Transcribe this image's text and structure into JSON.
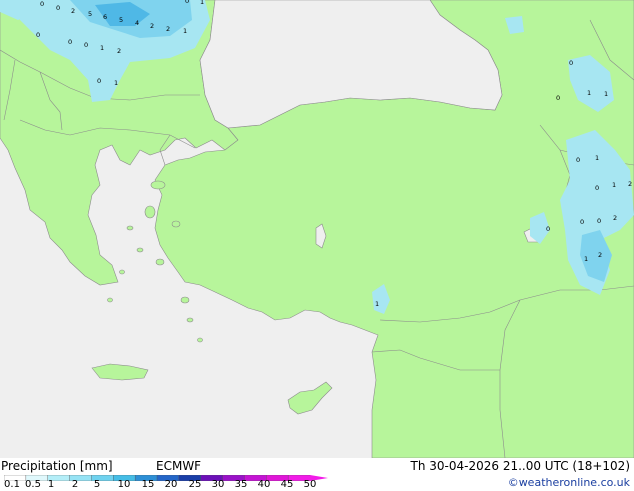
{
  "map": {
    "colors": {
      "sea": "#efefef",
      "land": "#b7f59b",
      "border": "#8c8c8c",
      "precip_light": "#a7e6f2",
      "precip_mid": "#7fd3ee",
      "precip_heavy": "#4fb8e6"
    },
    "precip_values": [
      "0",
      "0",
      "2",
      "5",
      "6",
      "5",
      "4",
      "2",
      "2",
      "1",
      "1",
      "0",
      "0",
      "1",
      "2",
      "0",
      "1",
      "0",
      "0",
      "1",
      "0",
      "1",
      "1",
      "1",
      "0",
      "1",
      "2",
      "0",
      "0",
      "2",
      "0",
      "0",
      "0",
      "1",
      "2"
    ]
  },
  "footer": {
    "title": "Precipitation [mm]",
    "model": "ECMWF",
    "valid": "Th 30-04-2026 21..00 UTC (18+102)",
    "credit": "©weatheronline.co.uk",
    "scale": [
      "0.1",
      "0.5",
      "1",
      "2",
      "5",
      "10",
      "15",
      "20",
      "25",
      "30",
      "35",
      "40",
      "45",
      "50"
    ],
    "scale_colors": [
      "#ffffff",
      "#e0f8fc",
      "#b4eef8",
      "#96e3f5",
      "#6fd2ef",
      "#45bde6",
      "#2d8fd6",
      "#2466c8",
      "#1a3ea8",
      "#6c10b8",
      "#9a12c8",
      "#c414d4",
      "#e016d8",
      "#f21ce8"
    ]
  }
}
